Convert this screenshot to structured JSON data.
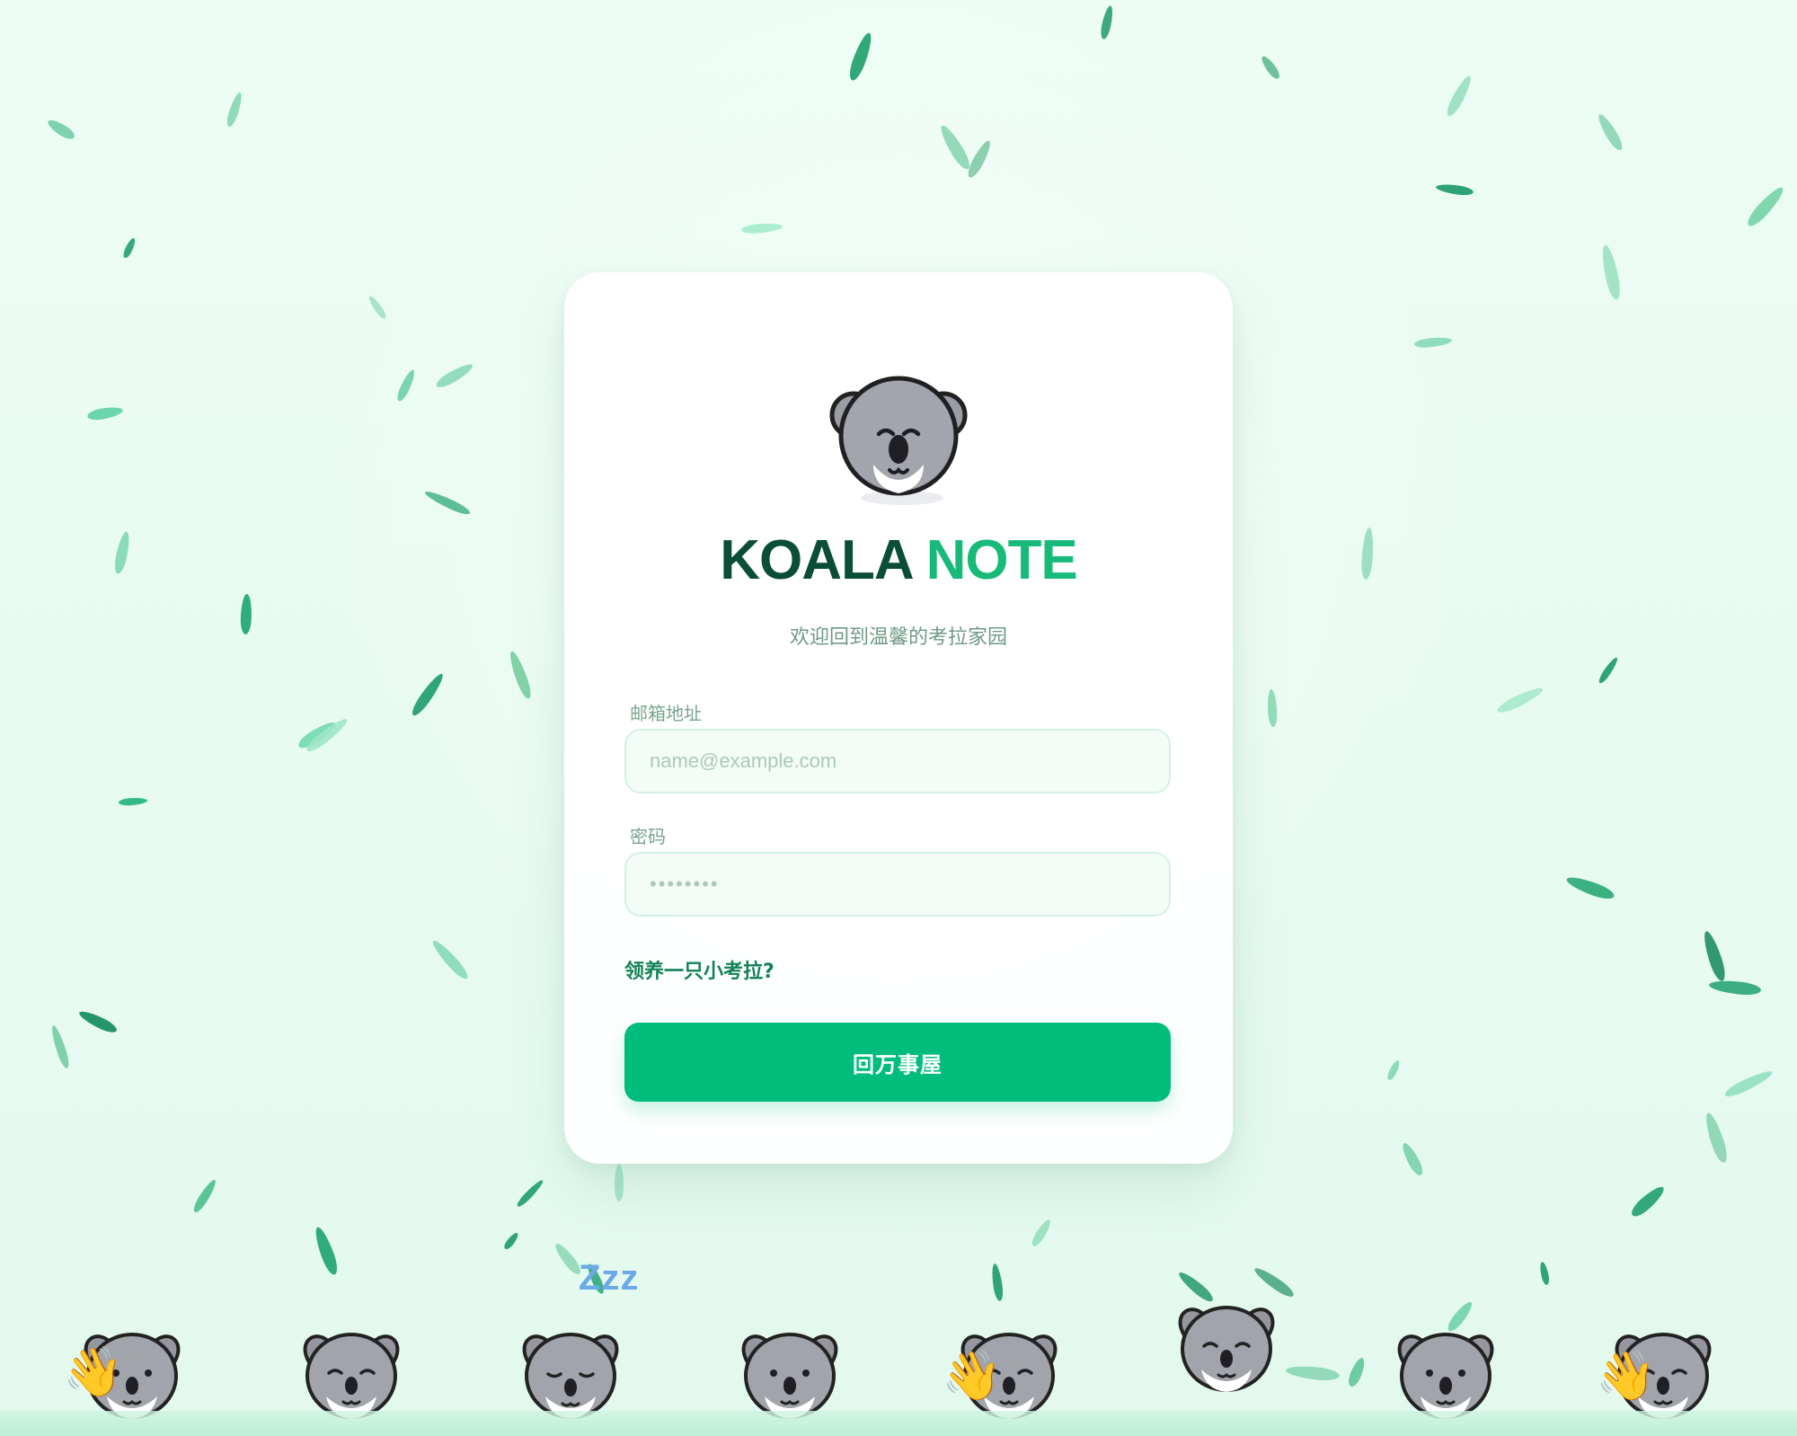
{
  "brand": {
    "part1": "KOALA",
    "part2": "NOTE"
  },
  "login": {
    "subtitle": "欢迎回到温馨的考拉家园",
    "email_label": "邮箱地址",
    "email_placeholder": "name@example.com",
    "email_value": "",
    "password_label": "密码",
    "password_placeholder": "••••••••",
    "password_value": "",
    "adopt_link": "领养一只小考拉?",
    "submit_label": "回万事屋"
  },
  "decorations": {
    "sleep_text": "Zzz",
    "wave_glyph": "👋"
  },
  "colors": {
    "background": "#e7fbf1",
    "brand_dark": "#0b4e38",
    "brand_green": "#18ba79",
    "primary_button": "#00bd7b",
    "link": "#128257",
    "sleep_text": "#6ba9e8"
  },
  "icons": {
    "logo": "koala-face-icon",
    "mascots": [
      "koala-waving-icon",
      "koala-happy-icon",
      "koala-sleeping-icon",
      "koala-neutral-icon",
      "koala-waving-icon",
      "koala-peeking-icon",
      "koala-neutral-icon",
      "koala-waving-icon"
    ]
  }
}
